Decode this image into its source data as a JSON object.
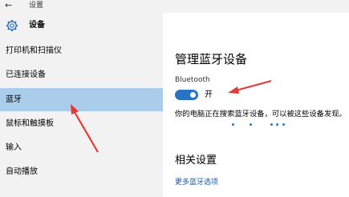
{
  "window": {
    "back_icon": "←",
    "title": "设置"
  },
  "sidebar": {
    "header_title": "设备",
    "items": [
      {
        "label": "打印机和扫描仪"
      },
      {
        "label": "已连接设备"
      },
      {
        "label": "蓝牙",
        "selected": true
      },
      {
        "label": "鼠标和触摸板"
      },
      {
        "label": "输入"
      },
      {
        "label": "自动播放"
      }
    ]
  },
  "main": {
    "title": "管理蓝牙设备",
    "bluetooth_label": "Bluetooth",
    "toggle_state": "开",
    "toggle_on": true,
    "discover_text": "你的电脑正在搜索蓝牙设备，可以被这些设备发现。",
    "related_title": "相关设置",
    "more_link": "更多蓝牙选项"
  },
  "colors": {
    "accent": "#2a73c4",
    "selected_bg": "#a9cdeb",
    "annotation_arrow": "#e53935"
  }
}
